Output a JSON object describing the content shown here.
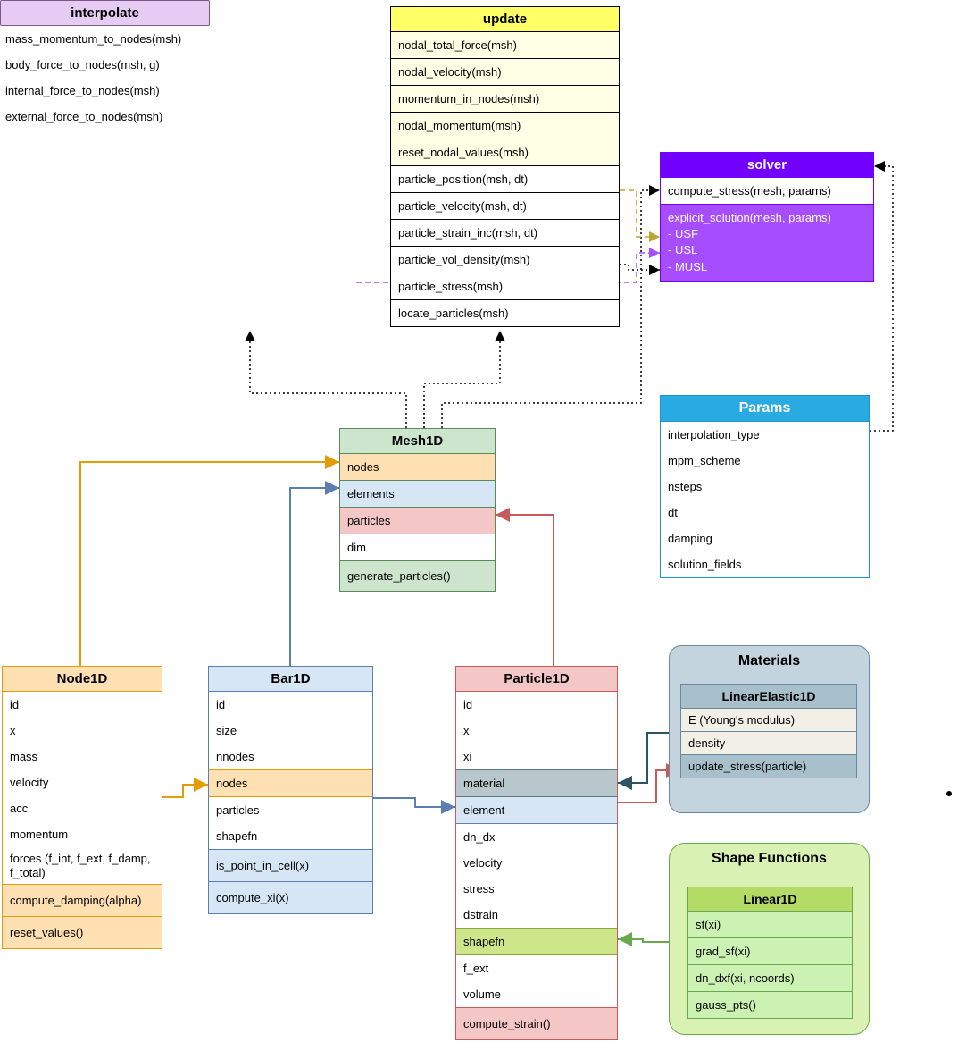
{
  "update": {
    "title": "update",
    "rows": [
      "nodal_total_force(msh)",
      "nodal_velocity(msh)",
      "momentum_in_nodes(msh)",
      "nodal_momentum(msh)",
      "reset_nodal_values(msh)",
      "particle_position(msh, dt)",
      "particle_velocity(msh, dt)",
      "particle_strain_inc(msh, dt)",
      "particle_vol_density(msh)",
      "particle_stress(msh)",
      "locate_particles(msh)"
    ]
  },
  "solver": {
    "title": "solver",
    "row0": "compute_stress(mesh, params)",
    "block_head": "explicit_solution(mesh, params)",
    "block_items": [
      "- USF",
      "- USL",
      "- MUSL"
    ]
  },
  "interpolate": {
    "title": "interpolate",
    "rows": [
      "mass_momentum_to_nodes(msh)",
      "body_force_to_nodes(msh, g)",
      "internal_force_to_nodes(msh)",
      "external_force_to_nodes(msh)"
    ]
  },
  "params": {
    "title": "Params",
    "rows": [
      "interpolation_type",
      "mpm_scheme",
      "nsteps",
      "dt",
      "damping",
      "solution_fields"
    ]
  },
  "mesh": {
    "title": "Mesh1D",
    "nodes": "nodes",
    "elements": "elements",
    "particles": "particles",
    "dim": "dim",
    "gen": "generate_particles()"
  },
  "node": {
    "title": "Node1D",
    "rows": [
      "id",
      "x",
      "mass",
      "velocity",
      "acc",
      "momentum"
    ],
    "forces": "forces (f_int, f_ext, f_damp, f_total)",
    "m1": "compute_damping(alpha)",
    "m2": "reset_values()"
  },
  "bar": {
    "title": "Bar1D",
    "rows": [
      "id",
      "size",
      "nnodes"
    ],
    "nodes": "nodes",
    "rows2": [
      "particles",
      "shapefn"
    ],
    "m1": "is_point_in_cell(x)",
    "m2": "compute_xi(x)"
  },
  "particle": {
    "title": "Particle1D",
    "rows1": [
      "id",
      "x",
      "xi"
    ],
    "material": "material",
    "element": "element",
    "rows2": [
      "dn_dx",
      "velocity",
      "stress",
      "dstrain"
    ],
    "shapefn": "shapefn",
    "rows3": [
      "f_ext",
      "volume"
    ],
    "m1": "compute_strain()"
  },
  "materials": {
    "title": "Materials",
    "inner_title": "LinearElastic1D",
    "rows": [
      "E (Young's modulus)",
      "density"
    ],
    "method": "update_stress(particle)"
  },
  "shapefns": {
    "title": "Shape Functions",
    "inner_title": "Linear1D",
    "rows": [
      "sf(xi)",
      "grad_sf(xi)",
      "dn_dxf(xi, ncoords)",
      "gauss_pts()"
    ]
  }
}
